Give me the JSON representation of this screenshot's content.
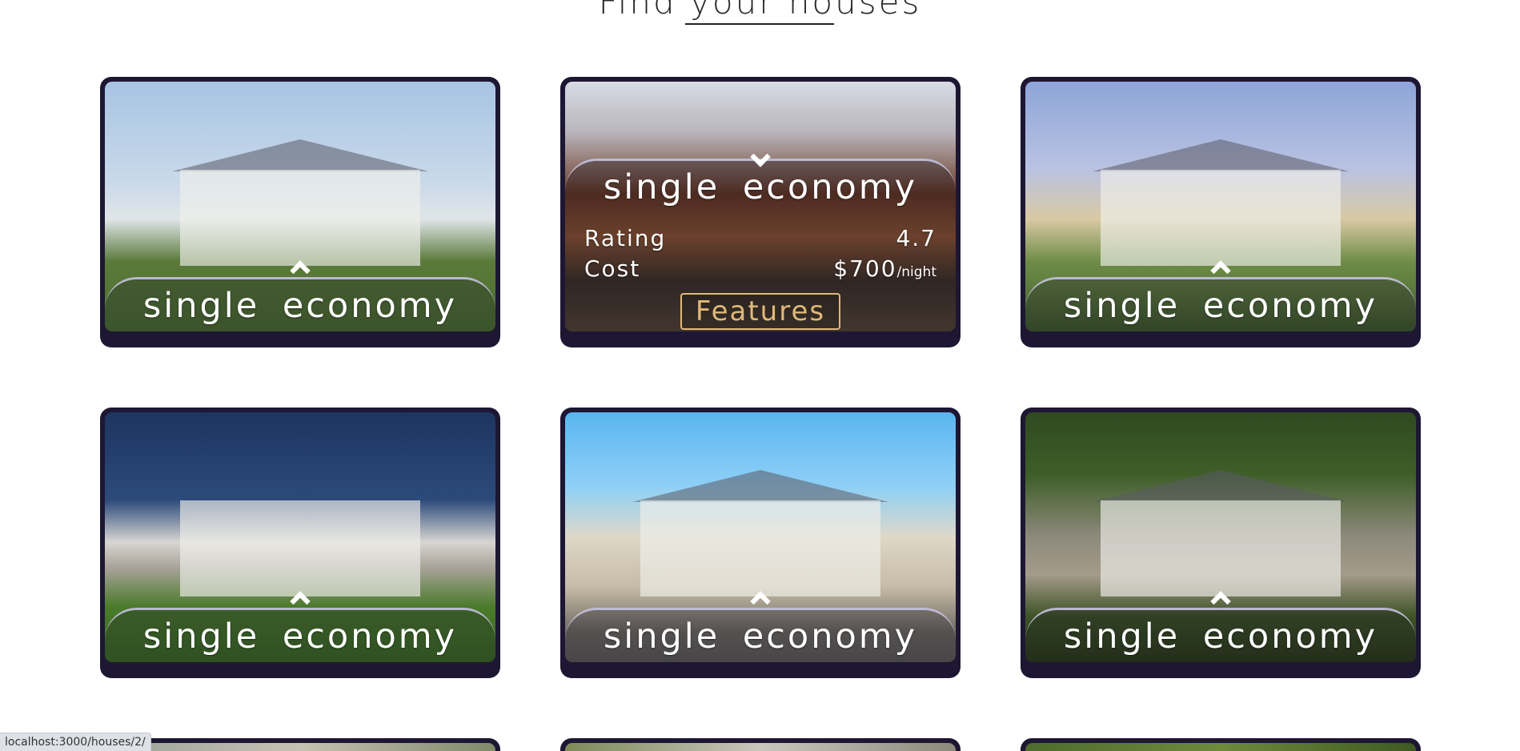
{
  "heading": {
    "text": "Find your houses"
  },
  "cards": [
    {
      "title": "single  economy"
    },
    {
      "title": "single  economy",
      "expanded": {
        "rating_label": "Rating",
        "rating_value": "4.7",
        "cost_label": "Cost",
        "cost_value": "$700",
        "cost_unit": "/night",
        "features_label": "Features"
      }
    },
    {
      "title": "single  economy"
    },
    {
      "title": "single  economy"
    },
    {
      "title": "single  economy"
    },
    {
      "title": "single  economy"
    }
  ],
  "status_bar": {
    "url": "localhost:3000/houses/2/"
  }
}
